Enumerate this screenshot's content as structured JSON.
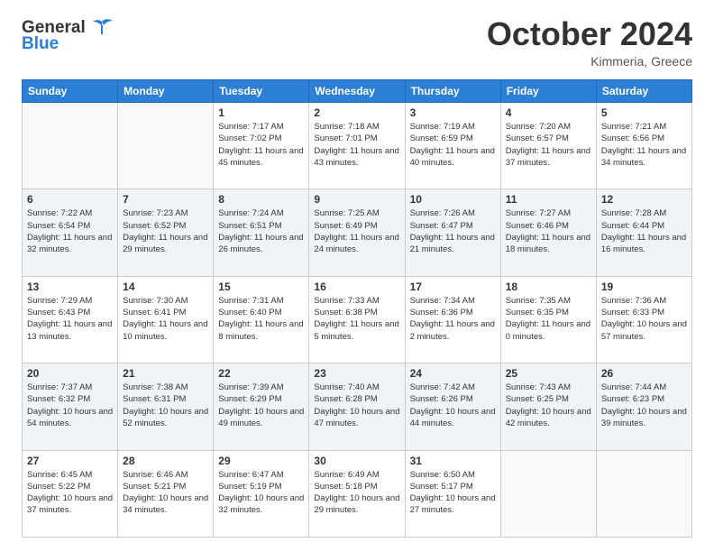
{
  "header": {
    "logo_general": "General",
    "logo_blue": "Blue",
    "month_title": "October 2024",
    "location": "Kimmeria, Greece"
  },
  "days_of_week": [
    "Sunday",
    "Monday",
    "Tuesday",
    "Wednesday",
    "Thursday",
    "Friday",
    "Saturday"
  ],
  "weeks": [
    [
      {
        "day": "",
        "sunrise": "",
        "sunset": "",
        "daylight": ""
      },
      {
        "day": "",
        "sunrise": "",
        "sunset": "",
        "daylight": ""
      },
      {
        "day": "1",
        "sunrise": "Sunrise: 7:17 AM",
        "sunset": "Sunset: 7:02 PM",
        "daylight": "Daylight: 11 hours and 45 minutes."
      },
      {
        "day": "2",
        "sunrise": "Sunrise: 7:18 AM",
        "sunset": "Sunset: 7:01 PM",
        "daylight": "Daylight: 11 hours and 43 minutes."
      },
      {
        "day": "3",
        "sunrise": "Sunrise: 7:19 AM",
        "sunset": "Sunset: 6:59 PM",
        "daylight": "Daylight: 11 hours and 40 minutes."
      },
      {
        "day": "4",
        "sunrise": "Sunrise: 7:20 AM",
        "sunset": "Sunset: 6:57 PM",
        "daylight": "Daylight: 11 hours and 37 minutes."
      },
      {
        "day": "5",
        "sunrise": "Sunrise: 7:21 AM",
        "sunset": "Sunset: 6:56 PM",
        "daylight": "Daylight: 11 hours and 34 minutes."
      }
    ],
    [
      {
        "day": "6",
        "sunrise": "Sunrise: 7:22 AM",
        "sunset": "Sunset: 6:54 PM",
        "daylight": "Daylight: 11 hours and 32 minutes."
      },
      {
        "day": "7",
        "sunrise": "Sunrise: 7:23 AM",
        "sunset": "Sunset: 6:52 PM",
        "daylight": "Daylight: 11 hours and 29 minutes."
      },
      {
        "day": "8",
        "sunrise": "Sunrise: 7:24 AM",
        "sunset": "Sunset: 6:51 PM",
        "daylight": "Daylight: 11 hours and 26 minutes."
      },
      {
        "day": "9",
        "sunrise": "Sunrise: 7:25 AM",
        "sunset": "Sunset: 6:49 PM",
        "daylight": "Daylight: 11 hours and 24 minutes."
      },
      {
        "day": "10",
        "sunrise": "Sunrise: 7:26 AM",
        "sunset": "Sunset: 6:47 PM",
        "daylight": "Daylight: 11 hours and 21 minutes."
      },
      {
        "day": "11",
        "sunrise": "Sunrise: 7:27 AM",
        "sunset": "Sunset: 6:46 PM",
        "daylight": "Daylight: 11 hours and 18 minutes."
      },
      {
        "day": "12",
        "sunrise": "Sunrise: 7:28 AM",
        "sunset": "Sunset: 6:44 PM",
        "daylight": "Daylight: 11 hours and 16 minutes."
      }
    ],
    [
      {
        "day": "13",
        "sunrise": "Sunrise: 7:29 AM",
        "sunset": "Sunset: 6:43 PM",
        "daylight": "Daylight: 11 hours and 13 minutes."
      },
      {
        "day": "14",
        "sunrise": "Sunrise: 7:30 AM",
        "sunset": "Sunset: 6:41 PM",
        "daylight": "Daylight: 11 hours and 10 minutes."
      },
      {
        "day": "15",
        "sunrise": "Sunrise: 7:31 AM",
        "sunset": "Sunset: 6:40 PM",
        "daylight": "Daylight: 11 hours and 8 minutes."
      },
      {
        "day": "16",
        "sunrise": "Sunrise: 7:33 AM",
        "sunset": "Sunset: 6:38 PM",
        "daylight": "Daylight: 11 hours and 5 minutes."
      },
      {
        "day": "17",
        "sunrise": "Sunrise: 7:34 AM",
        "sunset": "Sunset: 6:36 PM",
        "daylight": "Daylight: 11 hours and 2 minutes."
      },
      {
        "day": "18",
        "sunrise": "Sunrise: 7:35 AM",
        "sunset": "Sunset: 6:35 PM",
        "daylight": "Daylight: 11 hours and 0 minutes."
      },
      {
        "day": "19",
        "sunrise": "Sunrise: 7:36 AM",
        "sunset": "Sunset: 6:33 PM",
        "daylight": "Daylight: 10 hours and 57 minutes."
      }
    ],
    [
      {
        "day": "20",
        "sunrise": "Sunrise: 7:37 AM",
        "sunset": "Sunset: 6:32 PM",
        "daylight": "Daylight: 10 hours and 54 minutes."
      },
      {
        "day": "21",
        "sunrise": "Sunrise: 7:38 AM",
        "sunset": "Sunset: 6:31 PM",
        "daylight": "Daylight: 10 hours and 52 minutes."
      },
      {
        "day": "22",
        "sunrise": "Sunrise: 7:39 AM",
        "sunset": "Sunset: 6:29 PM",
        "daylight": "Daylight: 10 hours and 49 minutes."
      },
      {
        "day": "23",
        "sunrise": "Sunrise: 7:40 AM",
        "sunset": "Sunset: 6:28 PM",
        "daylight": "Daylight: 10 hours and 47 minutes."
      },
      {
        "day": "24",
        "sunrise": "Sunrise: 7:42 AM",
        "sunset": "Sunset: 6:26 PM",
        "daylight": "Daylight: 10 hours and 44 minutes."
      },
      {
        "day": "25",
        "sunrise": "Sunrise: 7:43 AM",
        "sunset": "Sunset: 6:25 PM",
        "daylight": "Daylight: 10 hours and 42 minutes."
      },
      {
        "day": "26",
        "sunrise": "Sunrise: 7:44 AM",
        "sunset": "Sunset: 6:23 PM",
        "daylight": "Daylight: 10 hours and 39 minutes."
      }
    ],
    [
      {
        "day": "27",
        "sunrise": "Sunrise: 6:45 AM",
        "sunset": "Sunset: 5:22 PM",
        "daylight": "Daylight: 10 hours and 37 minutes."
      },
      {
        "day": "28",
        "sunrise": "Sunrise: 6:46 AM",
        "sunset": "Sunset: 5:21 PM",
        "daylight": "Daylight: 10 hours and 34 minutes."
      },
      {
        "day": "29",
        "sunrise": "Sunrise: 6:47 AM",
        "sunset": "Sunset: 5:19 PM",
        "daylight": "Daylight: 10 hours and 32 minutes."
      },
      {
        "day": "30",
        "sunrise": "Sunrise: 6:49 AM",
        "sunset": "Sunset: 5:18 PM",
        "daylight": "Daylight: 10 hours and 29 minutes."
      },
      {
        "day": "31",
        "sunrise": "Sunrise: 6:50 AM",
        "sunset": "Sunset: 5:17 PM",
        "daylight": "Daylight: 10 hours and 27 minutes."
      },
      {
        "day": "",
        "sunrise": "",
        "sunset": "",
        "daylight": ""
      },
      {
        "day": "",
        "sunrise": "",
        "sunset": "",
        "daylight": ""
      }
    ]
  ]
}
